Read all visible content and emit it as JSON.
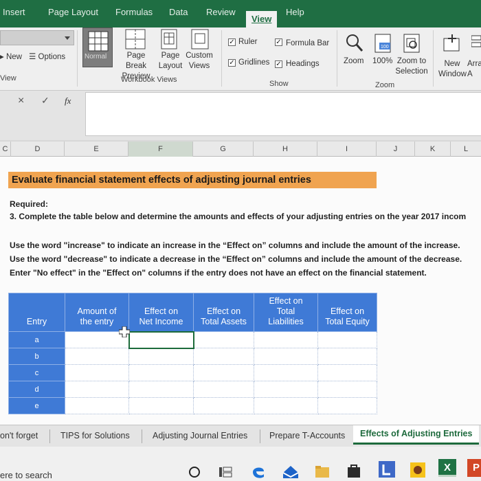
{
  "ribbon_tabs": [
    "Insert",
    "Page Layout",
    "Formulas",
    "Data",
    "Review",
    "View",
    "Help"
  ],
  "active_tab": "View",
  "ribbon": {
    "new_label": "New",
    "options_label": "Options",
    "view_label": "View",
    "normal_label": "Normal",
    "page_break_label": "Page Break",
    "preview_label": "Preview",
    "page_label": "Page",
    "layout_label": "Layout",
    "custom_label": "Custom",
    "views_label": "Views",
    "workbook_views_label": "Workbook Views",
    "ruler_label": "Ruler",
    "formula_bar_label": "Formula Bar",
    "gridlines_label": "Gridlines",
    "headings_label": "Headings",
    "show_label": "Show",
    "zoom_label": "Zoom",
    "zoom100_label": "100%",
    "zoom100_icon_text": "100",
    "zoom_to_label": "Zoom to",
    "selection_label": "Selection",
    "zoom_group_label": "Zoom",
    "new_label2": "New",
    "window_label": "Window",
    "arrange_label": "Arra",
    "arrange_label2": "A"
  },
  "formula_bar": {
    "cancel": "×",
    "enter": "✓",
    "fx": "fx"
  },
  "columns": [
    "C",
    "D",
    "E",
    "F",
    "G",
    "H",
    "I",
    "J",
    "K",
    "L"
  ],
  "selected_column": "F",
  "sheet": {
    "title": "Evaluate financial statement effects of adjusting journal entries",
    "required": "Required:",
    "instruction": "3. Complete the table below and determine the amounts and effects of your adjusting entries on the year 2017 incom",
    "note1": "Use the word \"increase\" to indicate an increase in the “Effect on” columns and include the amount of the increase.",
    "note2": "Use the word \"decrease\" to indicate a decrease in the “Effect on” columns and include the amount of the decrease.",
    "note3": "Enter \"No effect\" in the \"Effect on\" columns if the entry does not have an effect on the financial statement."
  },
  "table": {
    "headers": {
      "entry": "Entry",
      "amount_1": "Amount of",
      "amount_2": "the entry",
      "ni_1": "Effect on",
      "ni_2": "Net Income",
      "ta_1": "Effect on",
      "ta_2": "Total Assets",
      "tl_1": "Effect on",
      "tl_2": "Total",
      "tl_3": "Liabilities",
      "te_1": "Effect on",
      "te_2": "Total Equity"
    },
    "rows": [
      "a",
      "b",
      "c",
      "d",
      "e"
    ]
  },
  "sheet_tabs": [
    "on't forget",
    "TIPS for Solutions",
    "Adjusting Journal Entries",
    "Prepare T-Accounts",
    "Effects of Adjusting Entries"
  ],
  "active_sheet": "Effects of Adjusting Entries",
  "taskbar": {
    "search_text": "ere to search",
    "excel_letter": "X",
    "powerpoint_letter": "P"
  },
  "colors": {
    "ribbon_green": "#1f6e43",
    "table_blue": "#3f7ad6",
    "title_orange": "#f0a450"
  }
}
